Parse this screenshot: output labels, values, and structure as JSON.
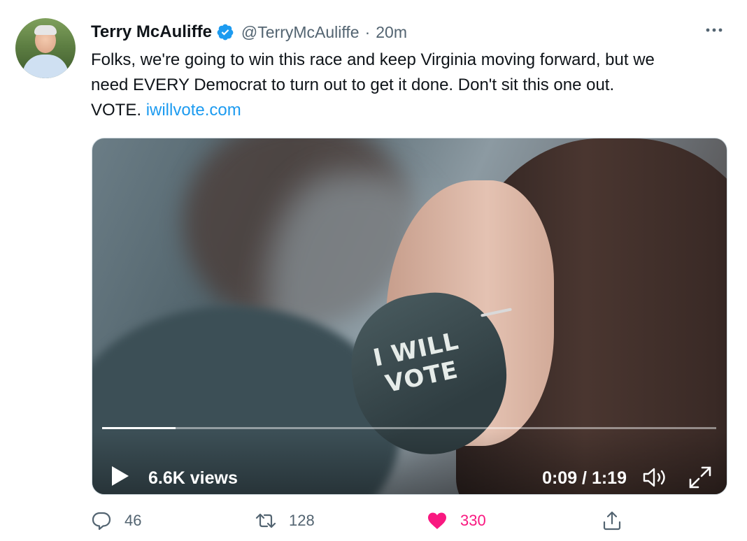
{
  "tweet": {
    "author_name": "Terry McAuliffe",
    "handle": "@TerryMcAuliffe",
    "separator": "·",
    "time": "20m",
    "text": "Folks, we're going to win this race and keep Virginia moving forward, but we\nneed EVERY Democrat to turn out to get it done. Don't sit this one out.\nVOTE. ",
    "link": "iwillvote.com",
    "verified": true
  },
  "media": {
    "mask_text": "I WILL\nVOTE",
    "views": "6.6K views",
    "duration": "0:09 / 1:19",
    "progress": 0.12
  },
  "actions": {
    "reply_count": "46",
    "retweet_count": "128",
    "like_count": "330",
    "liked": true
  },
  "colors": {
    "link": "#1d9bf0",
    "like": "#f91880",
    "secondary_text": "#536471"
  },
  "icons": [
    "verified-badge-icon",
    "more-icon",
    "play-icon",
    "volume-icon",
    "fullscreen-icon",
    "reply-icon",
    "retweet-icon",
    "heart-icon",
    "share-icon"
  ]
}
